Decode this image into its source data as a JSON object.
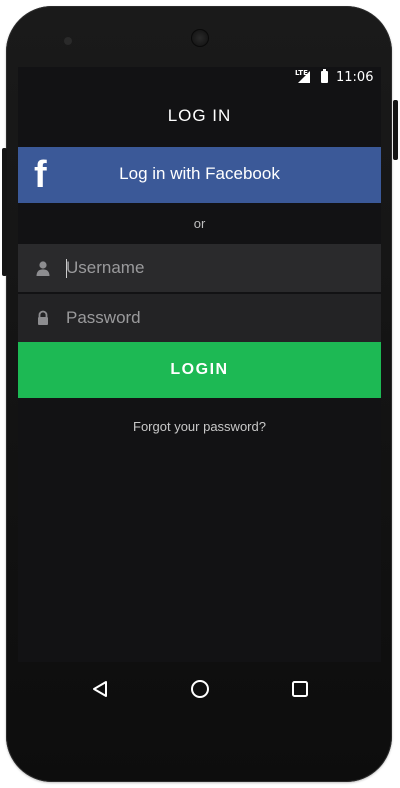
{
  "status_bar": {
    "network_label": "LTE",
    "time": "11:06",
    "signal_icon": "signal-icon",
    "battery_icon": "battery-icon"
  },
  "screen": {
    "title": "LOG IN",
    "facebook_button": {
      "icon_glyph": "f",
      "label": "Log in with Facebook",
      "color": "#3b5998"
    },
    "divider_text": "or",
    "username_field": {
      "placeholder": "Username",
      "value": "",
      "icon": "user-icon"
    },
    "password_field": {
      "placeholder": "Password",
      "value": "",
      "icon": "lock-icon"
    },
    "login_button": {
      "label": "LOGIN",
      "color": "#1db954"
    },
    "forgot_link": "Forgot your password?",
    "background_color": "#121214"
  },
  "nav_bar": {
    "back_icon": "back-triangle-icon",
    "home_icon": "home-circle-icon",
    "recents_icon": "recents-square-icon"
  }
}
